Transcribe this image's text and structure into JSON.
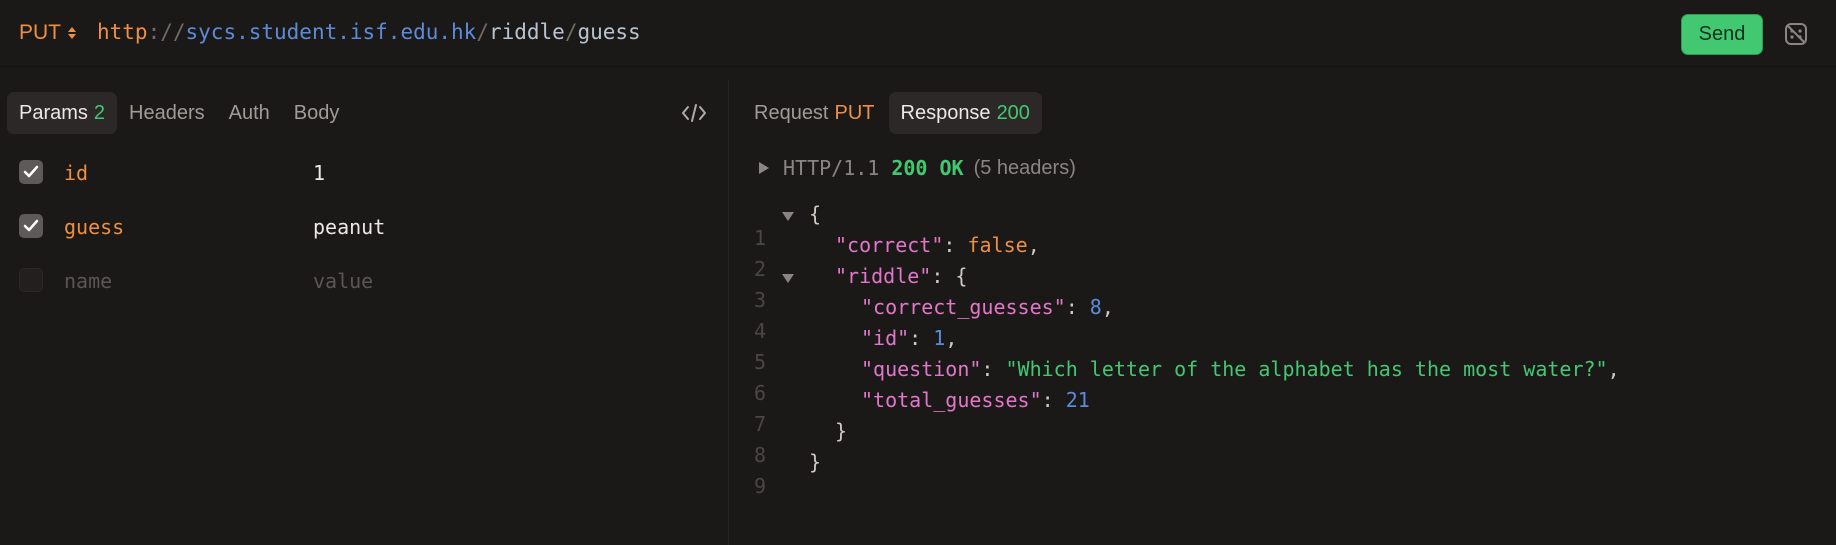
{
  "request": {
    "method": "PUT",
    "url": {
      "scheme": "http",
      "separator": "://",
      "host": "sycs.student.isf.edu.hk",
      "path_sep1": "/",
      "path1": "riddle",
      "path_sep2": "/",
      "path2": "guess"
    },
    "send_label": "Send"
  },
  "left_tabs": [
    {
      "label": "Params",
      "count": "2",
      "active": true
    },
    {
      "label": "Headers"
    },
    {
      "label": "Auth"
    },
    {
      "label": "Body"
    }
  ],
  "params": [
    {
      "checked": true,
      "name": "id",
      "value": "1"
    },
    {
      "checked": true,
      "name": "guess",
      "value": "peanut"
    },
    {
      "checked": false,
      "name_placeholder": "name",
      "value_placeholder": "value"
    }
  ],
  "right_tabs": {
    "request_label": "Request",
    "request_method": "PUT",
    "response_label": "Response",
    "response_status": "200"
  },
  "status_line": {
    "protocol": "HTTP/1.1",
    "code": "200 OK",
    "headers": "(5 headers)"
  },
  "response_lines": [
    {
      "n": "1",
      "text": "{"
    },
    {
      "n": "2",
      "key": "\"correct\"",
      "value": "false"
    },
    {
      "n": "3",
      "key": "\"riddle\"",
      "open": "{"
    },
    {
      "n": "4",
      "key": "\"correct_guesses\"",
      "value": "8"
    },
    {
      "n": "5",
      "key": "\"id\"",
      "value": "1"
    },
    {
      "n": "6",
      "key": "\"question\"",
      "value": "\"Which letter of the alphabet has the most water?\""
    },
    {
      "n": "7",
      "key": "\"total_guesses\"",
      "value": "21"
    },
    {
      "n": "8",
      "text": "}"
    },
    {
      "n": "9",
      "text": "}"
    }
  ],
  "colors": {
    "background": "#1b1918",
    "method": "#ee8f43",
    "success": "#43c872",
    "key": "#e277c9",
    "number": "#5b8bd9"
  },
  "icons": [
    "method-dropdown-icon",
    "settings-icon",
    "code-icon",
    "check-icon",
    "expand-icon",
    "collapse-icon"
  ]
}
